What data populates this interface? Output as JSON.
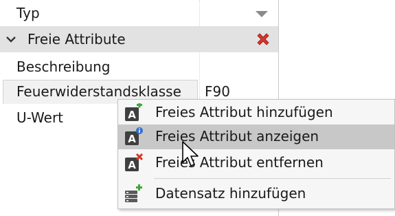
{
  "properties": {
    "rows": [
      {
        "name": "Typ",
        "value": ""
      },
      {
        "group_label": "Freie Attribute"
      },
      {
        "name": "Beschreibung",
        "value": ""
      },
      {
        "name": "Feuerwiderstandsklasse",
        "value": "F90"
      },
      {
        "name": "U-Wert",
        "value": ""
      }
    ]
  },
  "context_menu": {
    "items": [
      {
        "label": "Freies Attribut hinzufügen",
        "icon": "attribute-add-icon"
      },
      {
        "label": "Freies Attribut anzeigen",
        "icon": "attribute-info-icon",
        "highlighted": true
      },
      {
        "label": "Freies Attribut entfernen",
        "icon": "attribute-remove-icon"
      },
      {
        "label": "Datensatz hinzufügen",
        "icon": "dataset-add-icon"
      }
    ]
  },
  "icons": {
    "dropdown": "chevron-down-icon",
    "group_toggle": "chevron-down-icon",
    "group_delete": "close-icon",
    "pointer": "mouse-cursor-icon"
  },
  "colors": {
    "group_header": "#e2e2e2",
    "menu_highlight": "#c8c8c8",
    "add_badge": "#3aaa35",
    "info_badge": "#2f6fd1",
    "remove_badge": "#d9342b"
  }
}
